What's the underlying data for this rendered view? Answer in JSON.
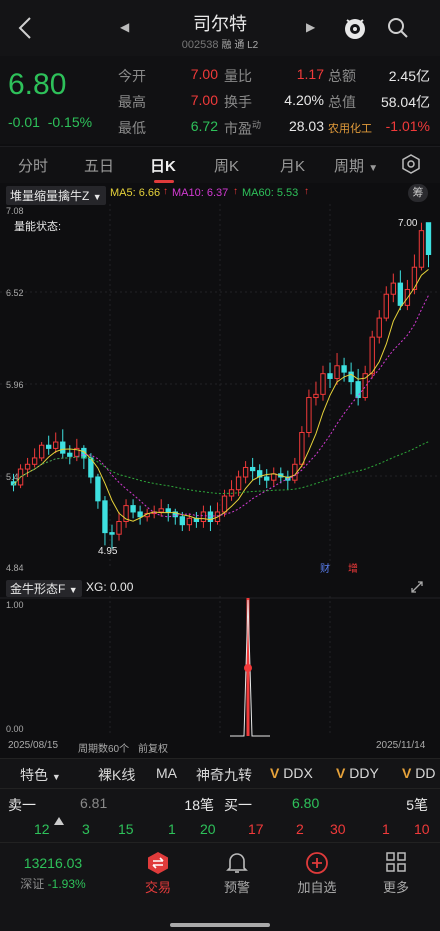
{
  "header": {
    "title": "司尔特",
    "code": "002538",
    "tags": "融 通 L2"
  },
  "quote": {
    "price": "6.80",
    "change": "-0.01",
    "change_pct": "-0.15%",
    "open_label": "今开",
    "open": "7.00",
    "high_label": "最高",
    "high": "7.00",
    "low_label": "最低",
    "low": "6.72",
    "vol_ratio_label": "量比",
    "vol_ratio": "1.17",
    "turnover_label": "换手",
    "turnover": "4.20%",
    "pe_label": "市盈",
    "pe_sup": "动",
    "pe": "28.03",
    "amount_label": "总额",
    "amount": "2.45亿",
    "mcap_label": "总值",
    "mcap": "58.04亿",
    "sector_label": "农用化工",
    "sector_pct": "-1.01%"
  },
  "tabs": [
    "分时",
    "五日",
    "日K",
    "周K",
    "月K",
    "周期"
  ],
  "indicator": {
    "name": "堆量缩量擒牛Z",
    "ma5": "MA5: 6.66",
    "ma10": "MA10: 6.37",
    "ma60": "MA60: 5.53",
    "chip_label": "筹",
    "state_text": "量能状态:"
  },
  "chart_labels": {
    "y_top": "7.08",
    "y2": "6.52",
    "y3": "5.96",
    "y4": "5.40",
    "y_bottom": "4.84",
    "low_mark": "4.95",
    "high_mark": "7.00",
    "fin_tag": "财",
    "hold_tag": "增"
  },
  "sub": {
    "name": "金牛形态F",
    "xg": "XG: 0.00",
    "y_top": "1.00",
    "y_bottom": "0.00"
  },
  "axis": {
    "start": "2025/08/15",
    "period": "周期数60个",
    "adj": "前复权",
    "end": "2025/11/14"
  },
  "toolrow": [
    "特色",
    "裸K线",
    "MA",
    "神奇九转",
    "DDX",
    "DDY",
    "DD"
  ],
  "book": {
    "sell_label": "卖一",
    "sell_price": "6.81",
    "sell_vol": "18笔",
    "buy_label": "买一",
    "buy_price": "6.80",
    "buy_vol": "5笔",
    "sell_details": [
      "12",
      "3",
      "15",
      "1",
      "20"
    ],
    "buy_details": [
      "17",
      "2",
      "30",
      "1",
      "10"
    ]
  },
  "bottomnav": {
    "index_value": "13216.03",
    "index_name": "深证",
    "index_pct": "-1.93%",
    "trade": "交易",
    "alert": "预警",
    "add": "加自选",
    "more": "更多"
  },
  "colors": {
    "up": "#f03a3a",
    "down": "#2ec15a",
    "ma5": "#e6d23a",
    "ma10": "#d33ad3",
    "ma60": "#2ea83a",
    "flat_candle": "#3ee0e0"
  },
  "chart_data": {
    "type": "candlestick",
    "ylim": [
      4.84,
      7.08
    ],
    "candles": [
      [
        5.37,
        5.35,
        5.42,
        5.31
      ],
      [
        5.35,
        5.45,
        5.48,
        5.33
      ],
      [
        5.45,
        5.48,
        5.52,
        5.4
      ],
      [
        5.48,
        5.52,
        5.58,
        5.46
      ],
      [
        5.52,
        5.6,
        5.62,
        5.5
      ],
      [
        5.6,
        5.58,
        5.66,
        5.54
      ],
      [
        5.58,
        5.62,
        5.68,
        5.55
      ],
      [
        5.62,
        5.55,
        5.7,
        5.52
      ],
      [
        5.55,
        5.53,
        5.6,
        5.48
      ],
      [
        5.53,
        5.58,
        5.64,
        5.5
      ],
      [
        5.58,
        5.52,
        5.6,
        5.45
      ],
      [
        5.52,
        5.4,
        5.55,
        5.36
      ],
      [
        5.4,
        5.25,
        5.42,
        5.2
      ],
      [
        5.25,
        5.05,
        5.28,
        4.97
      ],
      [
        5.05,
        5.04,
        5.1,
        4.95
      ],
      [
        5.04,
        5.12,
        5.18,
        5.0
      ],
      [
        5.12,
        5.22,
        5.26,
        5.08
      ],
      [
        5.22,
        5.18,
        5.26,
        5.14
      ],
      [
        5.18,
        5.15,
        5.22,
        5.1
      ],
      [
        5.15,
        5.17,
        5.2,
        5.12
      ],
      [
        5.17,
        5.18,
        5.22,
        5.14
      ],
      [
        5.18,
        5.2,
        5.26,
        5.15
      ],
      [
        5.2,
        5.18,
        5.23,
        5.12
      ],
      [
        5.18,
        5.15,
        5.2,
        5.1
      ],
      [
        5.15,
        5.1,
        5.18,
        5.06
      ],
      [
        5.1,
        5.14,
        5.17,
        5.06
      ],
      [
        5.14,
        5.12,
        5.18,
        5.08
      ],
      [
        5.12,
        5.18,
        5.22,
        5.08
      ],
      [
        5.18,
        5.12,
        5.22,
        5.06
      ],
      [
        5.12,
        5.18,
        5.24,
        5.1
      ],
      [
        5.18,
        5.28,
        5.32,
        5.15
      ],
      [
        5.28,
        5.32,
        5.38,
        5.25
      ],
      [
        5.32,
        5.4,
        5.44,
        5.28
      ],
      [
        5.4,
        5.46,
        5.5,
        5.36
      ],
      [
        5.46,
        5.44,
        5.52,
        5.38
      ],
      [
        5.44,
        5.4,
        5.48,
        5.35
      ],
      [
        5.4,
        5.38,
        5.45,
        5.33
      ],
      [
        5.38,
        5.42,
        5.46,
        5.34
      ],
      [
        5.42,
        5.4,
        5.46,
        5.36
      ],
      [
        5.4,
        5.38,
        5.44,
        5.32
      ],
      [
        5.38,
        5.48,
        5.52,
        5.36
      ],
      [
        5.48,
        5.68,
        5.72,
        5.46
      ],
      [
        5.68,
        5.9,
        5.95,
        5.65
      ],
      [
        5.9,
        5.92,
        6.0,
        5.85
      ],
      [
        5.92,
        6.05,
        6.1,
        5.88
      ],
      [
        6.05,
        6.02,
        6.12,
        5.96
      ],
      [
        6.02,
        6.1,
        6.18,
        5.98
      ],
      [
        6.1,
        6.06,
        6.15,
        6.0
      ],
      [
        6.06,
        6.0,
        6.12,
        5.92
      ],
      [
        6.0,
        5.9,
        6.08,
        5.85
      ],
      [
        5.9,
        6.05,
        6.1,
        5.88
      ],
      [
        6.05,
        6.28,
        6.32,
        6.02
      ],
      [
        6.28,
        6.4,
        6.45,
        6.24
      ],
      [
        6.4,
        6.55,
        6.6,
        6.38
      ],
      [
        6.55,
        6.62,
        6.68,
        6.5
      ],
      [
        6.62,
        6.48,
        6.7,
        6.45
      ],
      [
        6.48,
        6.58,
        6.64,
        6.45
      ],
      [
        6.58,
        6.72,
        6.8,
        6.55
      ],
      [
        6.72,
        6.95,
        7.0,
        6.7
      ],
      [
        7.0,
        6.8,
        7.0,
        6.72
      ]
    ]
  }
}
